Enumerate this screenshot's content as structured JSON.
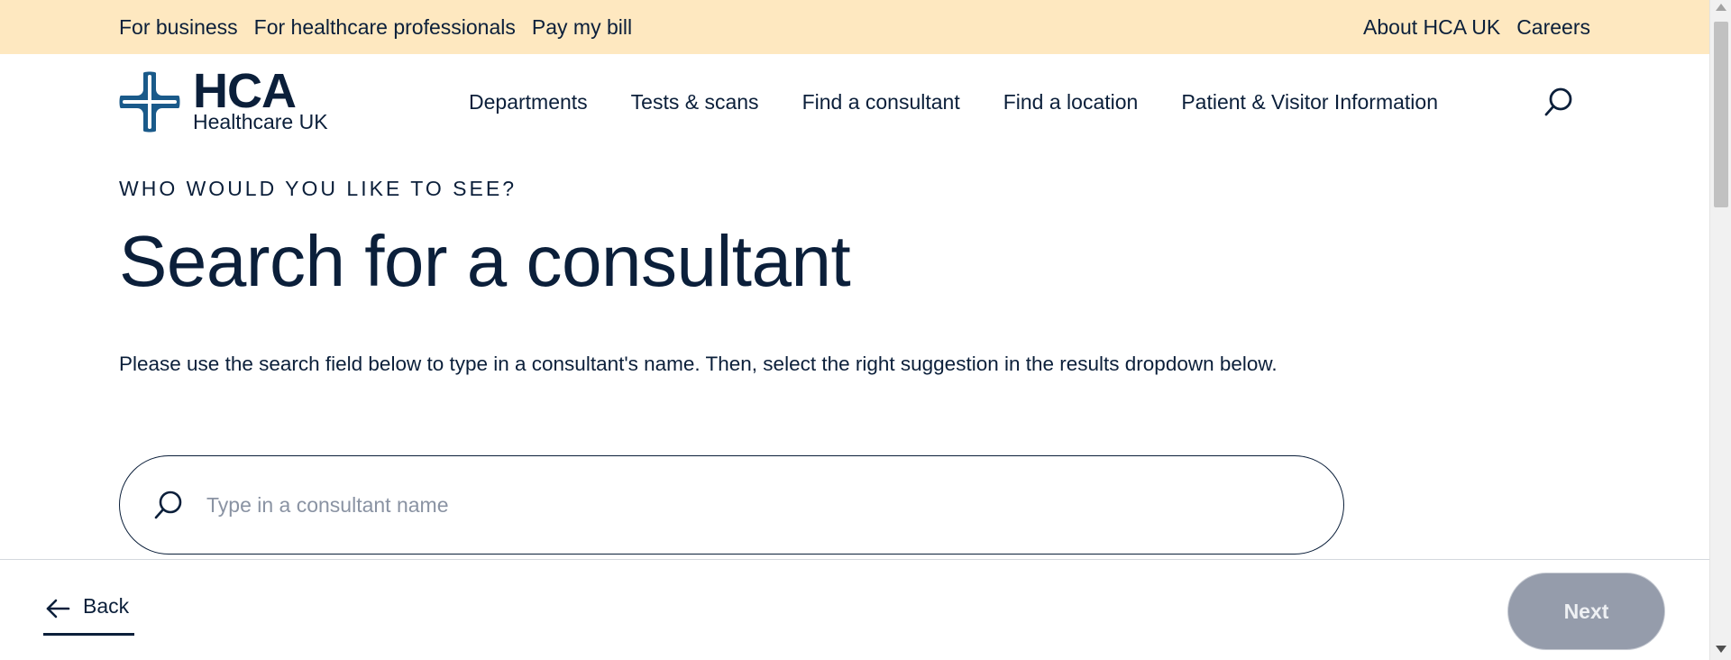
{
  "utility_nav": {
    "left": [
      "For business",
      "For healthcare professionals",
      "Pay my bill"
    ],
    "right": [
      "About HCA UK",
      "Careers"
    ]
  },
  "logo": {
    "wordmark": "HCA",
    "subtitle": "Healthcare UK"
  },
  "main_nav": {
    "items": [
      "Departments",
      "Tests & scans",
      "Find a consultant",
      "Find a location",
      "Patient & Visitor Information"
    ],
    "search_icon": "search-icon"
  },
  "main": {
    "eyebrow": "WHO WOULD YOU LIKE TO SEE?",
    "title": "Search for a consultant",
    "intro": "Please use the search field below to type in a consultant's name.  Then, select the right suggestion in the results dropdown below.",
    "search": {
      "placeholder": "Type in a consultant name",
      "value": ""
    }
  },
  "footer_bar": {
    "back_label": "Back",
    "next_label": "Next"
  },
  "colors": {
    "utility_bg": "#fee8c0",
    "navy": "#0b1f3a",
    "brand_blue": "#1a5a8a",
    "next_disabled": "#959cab"
  }
}
